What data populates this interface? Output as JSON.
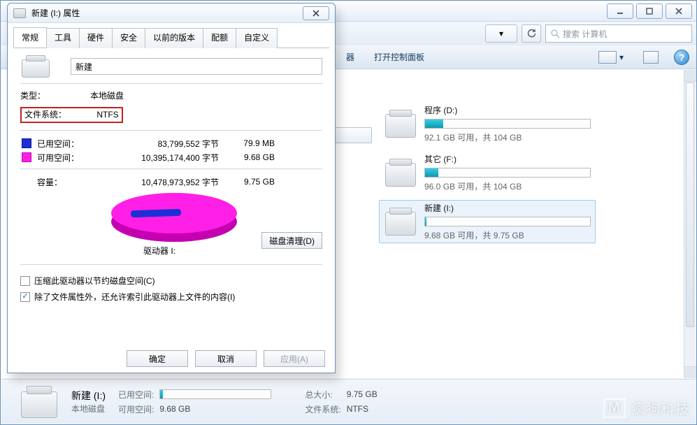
{
  "dialog": {
    "title": "新建 (I:) 属性",
    "tabs": [
      "常规",
      "工具",
      "硬件",
      "安全",
      "以前的版本",
      "配额",
      "自定义"
    ],
    "active_tab": 0,
    "volume_name": "新建",
    "type_label": "类型：",
    "type_value": "本地磁盘",
    "fs_label": "文件系统：",
    "fs_value": "NTFS",
    "used": {
      "label": "已用空间：",
      "bytes": "83,799,552 字节",
      "hr": "79.9 MB",
      "color": "#1f2fd6"
    },
    "free": {
      "label": "可用空间：",
      "bytes": "10,395,174,400 字节",
      "hr": "9.68 GB",
      "color": "#ff1fe6"
    },
    "capacity": {
      "label": "容量：",
      "bytes": "10,478,973,952 字节",
      "hr": "9.75 GB"
    },
    "drive_label": "驱动器 I:",
    "cleanup_btn": "磁盘清理(D)",
    "compress": {
      "checked": false,
      "label": "压缩此驱动器以节约磁盘空间(C)"
    },
    "index": {
      "checked": true,
      "label": "除了文件属性外，还允许索引此驱动器上文件的内容(I)"
    },
    "buttons": {
      "ok": "确定",
      "cancel": "取消",
      "apply": "应用(A)"
    }
  },
  "explorer": {
    "search_placeholder": "搜索 计算机",
    "toolbar": {
      "item1": "器",
      "item2": "打开控制面板"
    },
    "drives": [
      {
        "name": "程序 (D:)",
        "free": "92.1 GB 可用，共 104 GB",
        "pct": 11,
        "selected": false
      },
      {
        "name": "其它 (F:)",
        "free": "96.0 GB 可用，共 104 GB",
        "pct": 8,
        "selected": false
      },
      {
        "name": "新建 (I:)",
        "free": "9.68 GB 可用，共 9.75 GB",
        "pct": 1,
        "selected": true
      }
    ],
    "details": {
      "title": "新建 (I:)",
      "subtitle": "本地磁盘",
      "used_label": "已用空间:",
      "used_pct": 1,
      "free_label": "可用空间:",
      "free_value": "9.68 GB",
      "total_label": "总大小:",
      "total_value": "9.75 GB",
      "fs_label": "文件系统:",
      "fs_value": "NTFS"
    }
  },
  "watermark": "疯狗科技",
  "help_glyph": "?"
}
